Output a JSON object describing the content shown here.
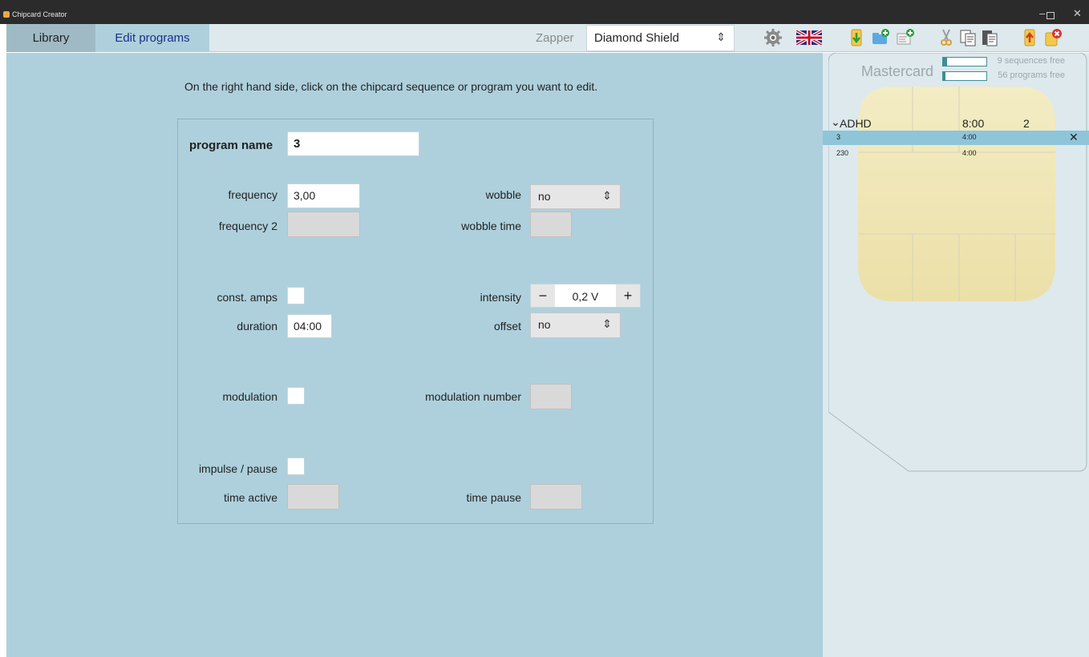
{
  "window": {
    "title": "Chipcard Creator",
    "controls": {
      "minimize": "–",
      "close": "✕"
    }
  },
  "tabs": [
    {
      "label": "Library",
      "active": false
    },
    {
      "label": "Edit programs",
      "active": true
    }
  ],
  "zapper": {
    "label": "Zapper",
    "selected": "Diamond Shield"
  },
  "toolbar_icons": [
    "settings-gear-icon",
    "uk-flag-icon",
    "import-icon",
    "new-folder-icon",
    "new-program-icon",
    "cut-icon",
    "copy-icon",
    "paste-icon",
    "upload-to-card-icon",
    "delete-card-icon"
  ],
  "instructions": "On the right hand side, click on the chipcard sequence or program you want to edit.",
  "form": {
    "program_name_label": "program name",
    "program_name_value": "3",
    "frequency_label": "frequency",
    "frequency_value": "3,00",
    "frequency2_label": "frequency 2",
    "frequency2_value": "",
    "wobble_label": "wobble",
    "wobble_value": "no",
    "wobble_time_label": "wobble time",
    "wobble_time_value": "",
    "const_amps_label": "const. amps",
    "intensity_label": "intensity",
    "intensity_value": "0,2 V",
    "intensity_minus": "−",
    "intensity_plus": "+",
    "duration_label": "duration",
    "duration_value": "04:00",
    "offset_label": "offset",
    "offset_value": "no",
    "modulation_label": "modulation",
    "modulation_number_label": "modulation number",
    "modulation_number_value": "",
    "impulse_pause_label": "impulse / pause",
    "time_active_label": "time active",
    "time_active_value": "",
    "time_pause_label": "time pause",
    "time_pause_value": ""
  },
  "card": {
    "title": "Mastercard",
    "sequences_free": "9 sequences free",
    "programs_free": "56 programs free",
    "sequences_used_fraction": 0.1,
    "programs_used_fraction": 0.05,
    "sequence": {
      "expander": "⌄",
      "name": "ADHD",
      "duration": "8:00",
      "count": "2"
    },
    "programs": [
      {
        "name": "3",
        "duration": "4:00",
        "selected": true,
        "remove": "✕"
      },
      {
        "name": "230",
        "duration": "4:00",
        "selected": false,
        "remove": ""
      }
    ]
  },
  "colors": {
    "main_bg": "#aed0dc",
    "panel_bg": "#dde9ed",
    "selected_row": "#8ec5d9",
    "accent": "#3f8d97",
    "tab_active_text": "#1b2f8a"
  }
}
